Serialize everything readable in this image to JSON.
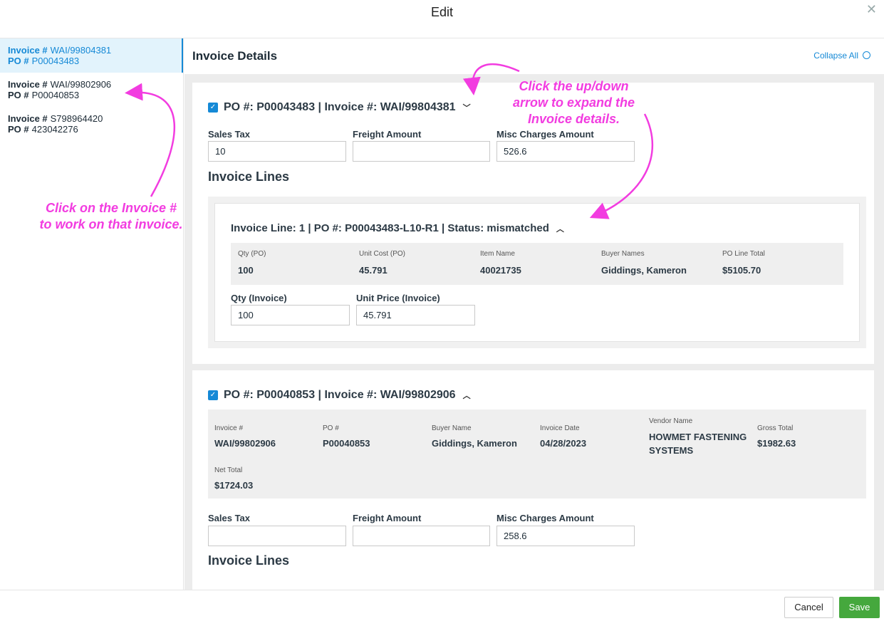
{
  "dialog": {
    "title": "Edit"
  },
  "sidebar": {
    "items": [
      {
        "invoice_label": "Invoice #",
        "invoice": "WAI/99804381",
        "po_label": "PO #",
        "po": "P00043483"
      },
      {
        "invoice_label": "Invoice #",
        "invoice": "WAI/99802906",
        "po_label": "PO #",
        "po": "P00040853"
      },
      {
        "invoice_label": "Invoice #",
        "invoice": "S798964420",
        "po_label": "PO #",
        "po": "423042276"
      }
    ]
  },
  "annotations": {
    "left_line1": "Click on the Invoice #",
    "left_line2": "to work on that invoice.",
    "right_line1": "Click the up/down",
    "right_line2": "arrow to expand the",
    "right_line3": "Invoice details.",
    "color": "#f23ce0"
  },
  "main": {
    "title": "Invoice Details",
    "collapse_all": "Collapse All",
    "invoices": [
      {
        "header": "PO #: P00043483 | Invoice #: WAI/99804381",
        "chevron": "chevron-down-icon",
        "fields": {
          "sales_tax_label": "Sales Tax",
          "sales_tax": "10",
          "freight_label": "Freight Amount",
          "freight": "",
          "misc_label": "Misc Charges Amount",
          "misc": "526.6"
        },
        "lines_title": "Invoice Lines",
        "lines": [
          {
            "header": "Invoice Line: 1 | PO #: P00043483-L10-R1 | Status: mismatched",
            "labels": [
              "Qty (PO)",
              "Unit Cost (PO)",
              "Item Name",
              "Buyer Names",
              "PO Line Total"
            ],
            "values": [
              "100",
              "45.791",
              "40021735",
              "Giddings, Kameron",
              "$5105.70"
            ],
            "qty_invoice_label": "Qty (Invoice)",
            "qty_invoice": "100",
            "unit_price_label": "Unit Price (Invoice)",
            "unit_price": "45.791"
          }
        ]
      },
      {
        "header": "PO #: P00040853 | Invoice #: WAI/99802906",
        "chevron": "chevron-up-icon",
        "summary": {
          "labels": [
            "Invoice #",
            "PO #",
            "Buyer Name",
            "Invoice Date",
            "Vendor Name",
            "Gross Total"
          ],
          "values": [
            "WAI/99802906",
            "P00040853",
            "Giddings, Kameron",
            "04/28/2023",
            "HOWMET FASTENING SYSTEMS",
            "$1982.63"
          ],
          "net_label": "Net Total",
          "net_value": "$1724.03"
        },
        "fields": {
          "sales_tax_label": "Sales Tax",
          "sales_tax": "",
          "freight_label": "Freight Amount",
          "freight": "",
          "misc_label": "Misc Charges Amount",
          "misc": "258.6"
        },
        "lines_title": "Invoice Lines"
      }
    ]
  },
  "footer": {
    "cancel": "Cancel",
    "save": "Save"
  },
  "colors": {
    "accent": "#1589d6",
    "save": "#45a83d",
    "active_bg": "#e2f3fc"
  }
}
